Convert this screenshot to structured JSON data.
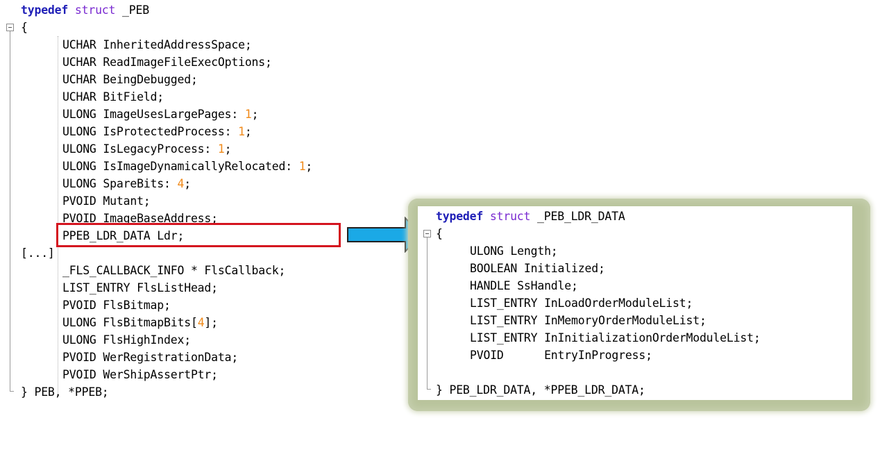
{
  "left_code": {
    "header_typedef": "typedef",
    "header_struct": "struct",
    "header_name": " _PEB",
    "open_brace": "{",
    "lines": [
      {
        "type": "UCHAR",
        "rest": " InheritedAddressSpace;"
      },
      {
        "type": "UCHAR",
        "rest": " ReadImageFileExecOptions;"
      },
      {
        "type": "UCHAR",
        "rest": " BeingDebugged;"
      },
      {
        "type": "UCHAR",
        "rest": " BitField;"
      },
      {
        "type": "ULONG",
        "rest": " ImageUsesLargePages: ",
        "num": "1",
        "tail": ";"
      },
      {
        "type": "ULONG",
        "rest": " IsProtectedProcess: ",
        "num": "1",
        "tail": ";"
      },
      {
        "type": "ULONG",
        "rest": " IsLegacyProcess: ",
        "num": "1",
        "tail": ";"
      },
      {
        "type": "ULONG",
        "rest": " IsImageDynamicallyRelocated: ",
        "num": "1",
        "tail": ";"
      },
      {
        "type": "ULONG",
        "rest": " SpareBits: ",
        "num": "4",
        "tail": ";"
      },
      {
        "type": "PVOID",
        "rest": " Mutant;"
      },
      {
        "type": "PVOID",
        "rest": " ImageBaseAddress;"
      },
      {
        "type": "PPEB_LDR_DATA",
        "rest": " Ldr;"
      }
    ],
    "ellipsis": "[...]",
    "lines2": [
      {
        "type": "_FLS_CALLBACK_INFO",
        "rest": " * FlsCallback;"
      },
      {
        "type": "LIST_ENTRY",
        "rest": " FlsListHead;"
      },
      {
        "type": "PVOID",
        "rest": " FlsBitmap;"
      },
      {
        "type": "ULONG",
        "rest": " FlsBitmapBits[",
        "num": "4",
        "tail": "];"
      },
      {
        "type": "ULONG",
        "rest": " FlsHighIndex;"
      },
      {
        "type": "PVOID",
        "rest": " WerRegistrationData;"
      },
      {
        "type": "PVOID",
        "rest": " WerShipAssertPtr;"
      }
    ],
    "close": "} PEB, *PPEB;"
  },
  "right_code": {
    "header_typedef": "typedef",
    "header_struct": "struct",
    "header_name": " _PEB_LDR_DATA",
    "open_brace": "{",
    "lines": [
      "ULONG Length;",
      "BOOLEAN Initialized;",
      "HANDLE SsHandle;",
      "LIST_ENTRY InLoadOrderModuleList;",
      "LIST_ENTRY InMemoryOrderModuleList;",
      "LIST_ENTRY InInitializationOrderModuleList;",
      "PVOID      EntryInProgress;"
    ],
    "close": "} PEB_LDR_DATA, *PPEB_LDR_DATA;"
  },
  "colors": {
    "keyword": "#1f1fb7",
    "struct_keyword": "#7a2bd1",
    "number": "#f08a1a",
    "highlight_border": "#d4141f",
    "arrow_fill": "#1ba9e6",
    "frame": "#b9c49c"
  }
}
